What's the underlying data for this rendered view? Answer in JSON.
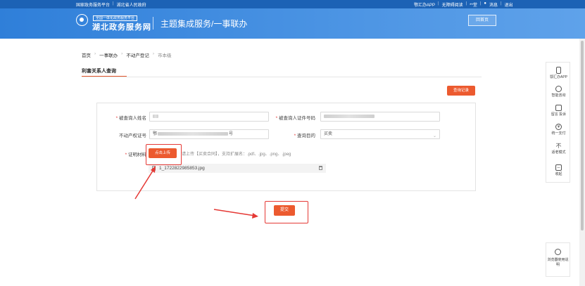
{
  "topbar": {
    "left_links": [
      "国家政务服务平台",
      "湖北省人民政府"
    ],
    "right_links": [
      "鄂汇办APP",
      "无障碍阅读",
      "**堂",
      "消息",
      "退出"
    ]
  },
  "header": {
    "logo_sub": "全国一体化政务服务平台",
    "logo_title": "湖北政务服务网",
    "page_title": "主题集成服务/一事联办",
    "home_button": "回首页"
  },
  "breadcrumb": [
    "首页",
    "一事联办",
    "不动产登记",
    "市本级"
  ],
  "section_tab": "利害关系人查询",
  "query_record_button": "查询记录",
  "form": {
    "name_label": "被查询人姓名",
    "id_label": "被查询人证件号码",
    "cert_label": "不动产权证号",
    "cert_value_prefix": "鄂",
    "cert_value_suffix": "号",
    "purpose_label": "查询目的",
    "purpose_value": "买卖",
    "material_label": "证明材料",
    "upload_button": "点击上传",
    "upload_hint": "请上传【买卖合同】，支持扩展名：.pdf、.jpg、.png、.jpeg",
    "file_name": "1_1722822985853.jpg",
    "submit_button": "提交"
  },
  "side_tools": [
    {
      "label": "鄂汇办APP",
      "icon": "phone-icon"
    },
    {
      "label": "智能咨询",
      "icon": "headset-icon"
    },
    {
      "label": "留言 投诉",
      "icon": "message-icon"
    },
    {
      "label": "统一支付",
      "icon": "yuan-icon"
    },
    {
      "label": "适老模式",
      "icon": "elder-mode-icon"
    },
    {
      "label": "收起",
      "icon": "collapse-icon"
    }
  ],
  "side_browser_label": "浏览器使用说明",
  "colors": {
    "topbar": "#1c62b5",
    "header": "#3a88de",
    "accent": "#ec5a2f",
    "annotation": "#e53935"
  }
}
